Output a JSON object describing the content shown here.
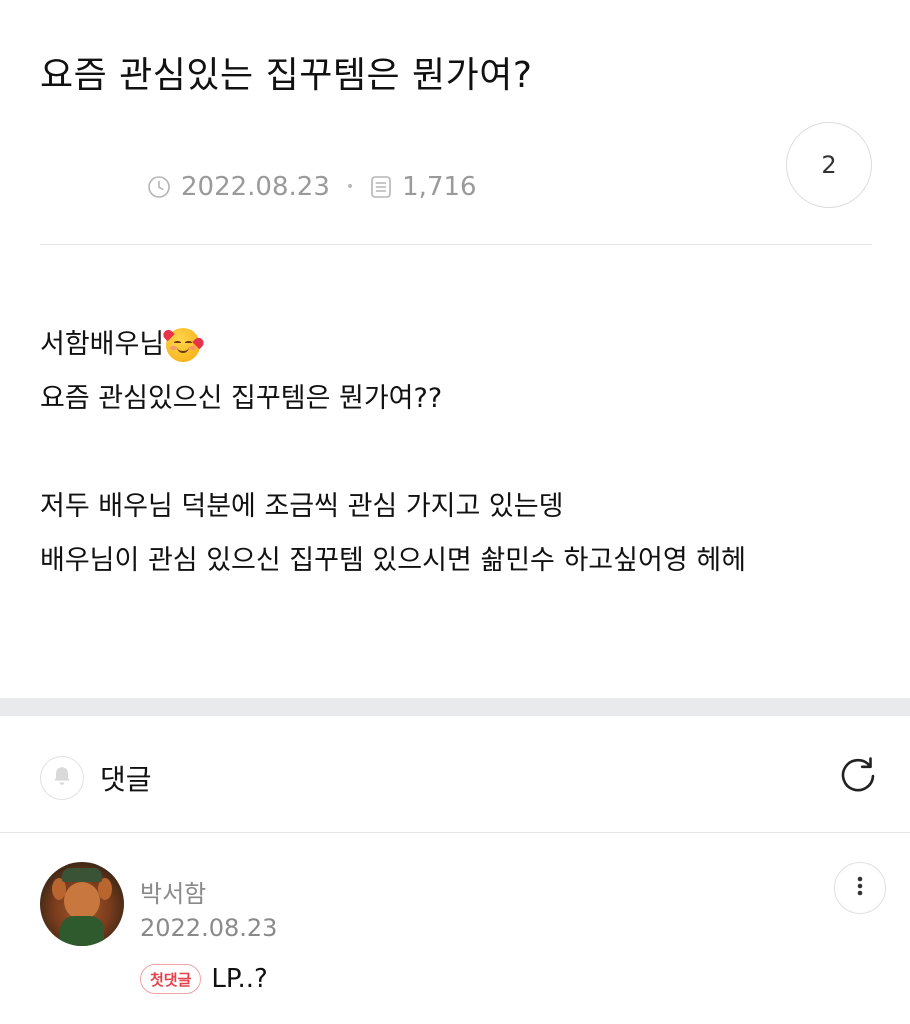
{
  "post": {
    "title": "요즘 관심있는 집꾸템은 뭔가여?",
    "comment_count": "2",
    "date": "2022.08.23",
    "views": "1,716",
    "body_lines": [
      "서함배우님",
      "요즘 관심있으신 집꾸템은 뭔가여??",
      "",
      "저두 배우님 덕분에 조금씩 관심 가지고 있는뎅",
      "배우님이 관심 있으신 집꾸템 있으시면 솲민수 하고싶어영 헤헤"
    ],
    "emoji": "smiling-face-with-hearts"
  },
  "comments_section": {
    "label": "댓글"
  },
  "comments": [
    {
      "author": "박서함",
      "date": "2022.08.23",
      "badge": "첫댓글",
      "text": "LP..?"
    }
  ],
  "colors": {
    "meta_gray": "#9a9a9a",
    "badge_red": "#e5424d",
    "section_gap": "#e9eaec"
  }
}
